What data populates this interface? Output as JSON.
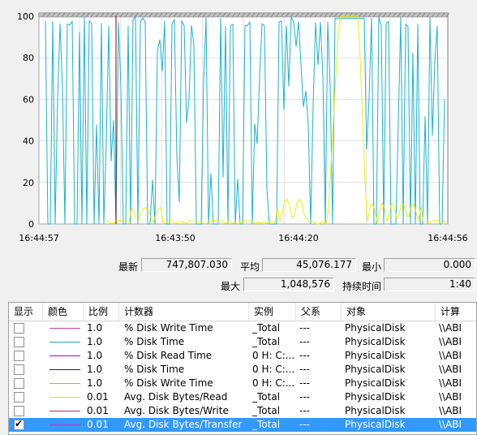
{
  "graph": {
    "y_ticks": [
      "100",
      "80",
      "60",
      "40",
      "20",
      "0"
    ],
    "x_ticks": [
      "16:44:57",
      "16:43:50",
      "16:44:20",
      "16:44:56"
    ],
    "colors": {
      "cyan": "#19b4d2",
      "yellow": "#f0f000",
      "marker": "#8b0000",
      "grid": "#c8c8c8"
    }
  },
  "stats": {
    "latest_label": "最新",
    "latest_value": "747,807.030",
    "average_label": "平均",
    "average_value": "45,076.177",
    "min_label": "最小",
    "min_value": "0.000",
    "max_label": "最大",
    "max_value": "1,048,576",
    "duration_label": "持续时间",
    "duration_value": "1:40"
  },
  "table": {
    "headers": [
      "显示",
      "颜色",
      "比例",
      "计数器",
      "实例",
      "父系",
      "对象",
      "计算"
    ],
    "rows": [
      {
        "checked": false,
        "color": "#d040a0",
        "scale": "1.0",
        "counter": "% Disk Write Time",
        "instance": "_Total",
        "parent": "---",
        "object": "PhysicalDisk",
        "computer": "\\\\ABI",
        "selected": false
      },
      {
        "checked": false,
        "color": "#10b0c8",
        "scale": "1.0",
        "counter": "% Disk Time",
        "instance": "_Total",
        "parent": "---",
        "object": "PhysicalDisk",
        "computer": "\\\\ABI",
        "selected": false
      },
      {
        "checked": false,
        "color": "#c000c0",
        "scale": "1.0",
        "counter": "% Disk Read Time",
        "instance": "0 H: C:...",
        "parent": "---",
        "object": "PhysicalDisk",
        "computer": "\\\\ABI",
        "selected": false
      },
      {
        "checked": false,
        "color": "#500070",
        "scale": "1.0",
        "counter": "% Disk Time",
        "instance": "0 H: C:...",
        "parent": "---",
        "object": "PhysicalDisk",
        "computer": "\\\\ABI",
        "selected": false
      },
      {
        "checked": false,
        "color": "#d0b000",
        "scale": "1.0",
        "counter": "% Disk Write Time",
        "instance": "0 H: C:...",
        "parent": "---",
        "object": "PhysicalDisk",
        "computer": "\\\\ABI",
        "selected": false
      },
      {
        "checked": false,
        "color": "#e0e000",
        "scale": "0.01",
        "counter": "Avg. Disk Bytes/Read",
        "instance": "_Total",
        "parent": "---",
        "object": "PhysicalDisk",
        "computer": "\\\\ABI",
        "selected": false
      },
      {
        "checked": false,
        "color": "#b03060",
        "scale": "0.01",
        "counter": "Avg. Disk Bytes/Write",
        "instance": "_Total",
        "parent": "---",
        "object": "PhysicalDisk",
        "computer": "\\\\ABI",
        "selected": false
      },
      {
        "checked": true,
        "color": "#b040b0",
        "scale": "0.01",
        "counter": "Avg. Disk Bytes/Transfer",
        "instance": "_Total",
        "parent": "---",
        "object": "PhysicalDisk",
        "computer": "\\\\ABI",
        "selected": true
      }
    ]
  }
}
